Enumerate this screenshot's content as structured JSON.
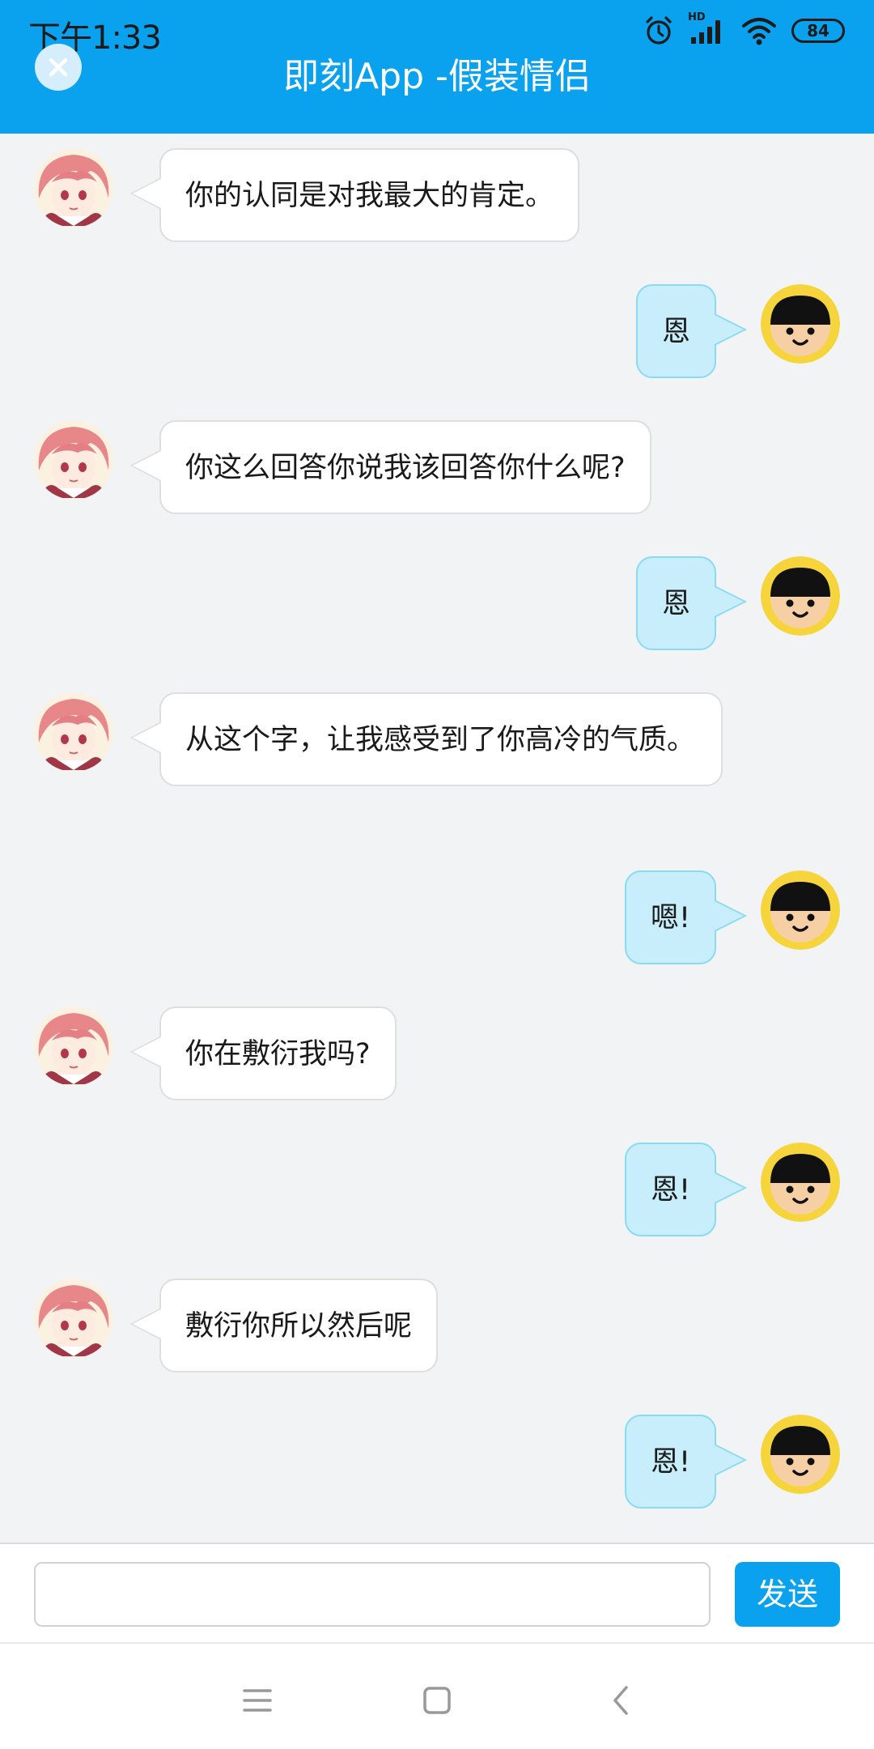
{
  "status_bar": {
    "time": "下午1:33",
    "battery": "84",
    "network_label": "HD",
    "icons": [
      "alarm-icon",
      "signal-icon",
      "wifi-icon",
      "battery-icon"
    ]
  },
  "header": {
    "title": "即刻App -假装情侣",
    "close_icon": "close-icon",
    "background_color": "#0aa1ee"
  },
  "messages": [
    {
      "side": "left",
      "text": "你的认同是对我最大的肯定。",
      "avatar": "anime-girl-avatar"
    },
    {
      "side": "right",
      "text": "恩",
      "avatar": "smiley-boy-avatar"
    },
    {
      "side": "left",
      "text": "你这么回答你说我该回答你什么呢?",
      "avatar": "anime-girl-avatar"
    },
    {
      "side": "right",
      "text": "恩",
      "avatar": "smiley-boy-avatar"
    },
    {
      "side": "left",
      "text": "从这个字，让我感受到了你高冷的气质。",
      "avatar": "anime-girl-avatar"
    },
    {
      "side": "right",
      "text": "嗯!",
      "avatar": "smiley-boy-avatar"
    },
    {
      "side": "left",
      "text": "你在敷衍我吗?",
      "avatar": "anime-girl-avatar"
    },
    {
      "side": "right",
      "text": "恩!",
      "avatar": "smiley-boy-avatar"
    },
    {
      "side": "left",
      "text": "敷衍你所以然后呢",
      "avatar": "anime-girl-avatar"
    },
    {
      "side": "right",
      "text": "恩!",
      "avatar": "smiley-boy-avatar"
    }
  ],
  "input": {
    "value": "",
    "placeholder": ""
  },
  "send_button": {
    "label": "发送",
    "color": "#0aa1ee"
  },
  "nav_bar": {
    "icons": [
      "menu-icon",
      "home-icon",
      "back-icon"
    ]
  }
}
